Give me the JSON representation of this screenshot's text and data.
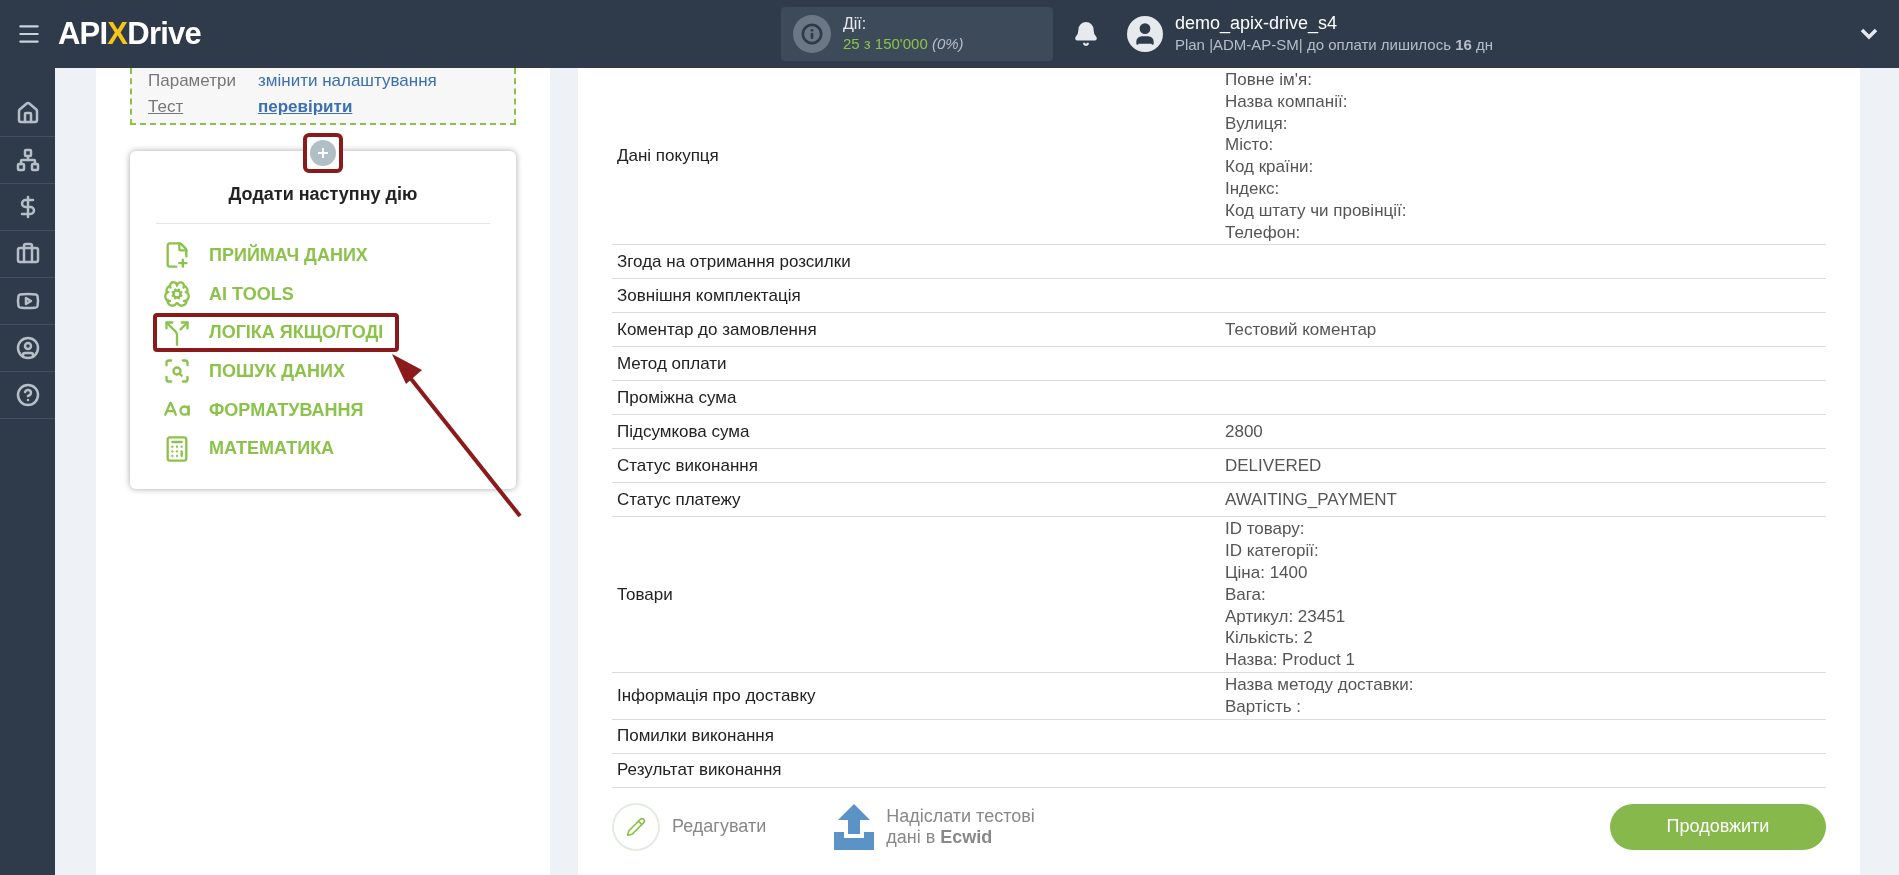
{
  "header": {
    "logo": {
      "left": "API",
      "mark": "X",
      "right": "Drive"
    },
    "actions": {
      "label": "Дії:",
      "count": "25 з 150'000",
      "percent": "(0%)"
    },
    "user": {
      "name": "demo_apix-drive_s4",
      "plan": "Plan |ADM-AP-SM| до оплати лишилось **16** дн"
    }
  },
  "settings": [
    {
      "label": "Параметри",
      "link": "змінити налаштування"
    },
    {
      "label": "Тест",
      "link": "перевірити"
    }
  ],
  "add_action": {
    "plus_highlighted": true,
    "title": "Додати наступну дію",
    "items": [
      {
        "kind": "receiver",
        "label": "ПРИЙМАЧ ДАНИХ",
        "highlighted": false
      },
      {
        "kind": "ai",
        "label": "AI TOOLS",
        "highlighted": false
      },
      {
        "kind": "logic",
        "label": "ЛОГІКА ЯКЩО/ТОДІ",
        "highlighted": true
      },
      {
        "kind": "search",
        "label": "ПОШУК ДАНИХ",
        "highlighted": false
      },
      {
        "kind": "format",
        "label": "ФОРМАТУВАННЯ",
        "highlighted": false
      },
      {
        "kind": "math",
        "label": "МАТЕМАТИКА",
        "highlighted": false
      }
    ]
  },
  "table": {
    "rows": [
      {
        "label": "Дані покупця",
        "values": [
          "Повне ім'я:",
          "Назва компанії:",
          "Вулиця:",
          "Місто:",
          "Код країни:",
          "Індекс:",
          "Код штату чи провінції:",
          "Телефон:"
        ]
      },
      {
        "label": "Згода на отримання розсилки",
        "values": []
      },
      {
        "label": "Зовнішня комплектація",
        "values": []
      },
      {
        "label": "Коментар до замовлення",
        "values": [
          "Тестовий коментар"
        ]
      },
      {
        "label": "Метод оплати",
        "values": []
      },
      {
        "label": "Проміжна сума",
        "values": []
      },
      {
        "label": "Підсумкова сума",
        "values": [
          "2800"
        ]
      },
      {
        "label": "Статус виконання",
        "values": [
          "DELIVERED"
        ]
      },
      {
        "label": "Статус платежу",
        "values": [
          "AWAITING_PAYMENT"
        ]
      },
      {
        "label": "Товари",
        "values": [
          "ID товару:",
          "ID категорії:",
          "Ціна: 1400",
          "Вага:",
          "Артикул: 23451",
          "Кількість: 2",
          "Назва: Product 1"
        ]
      },
      {
        "label": "Інформація про доставку",
        "values": [
          "Назва методу доставки:",
          "Вартість :"
        ]
      },
      {
        "label": "Помилки виконання",
        "values": []
      },
      {
        "label": "Результат виконання",
        "values": []
      }
    ]
  },
  "footer": {
    "edit": "Редагувати",
    "send_line1": "Надіслати тестові",
    "send_line2": "дані в **Ecwid**",
    "continue": "Продовжити"
  }
}
